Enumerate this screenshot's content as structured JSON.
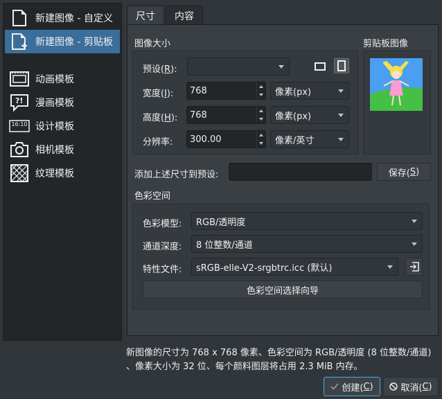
{
  "sidebar": {
    "items": [
      {
        "label": "新建图像 - 自定义",
        "icon": "new-document-icon"
      },
      {
        "label": "新建图像 - 剪贴板",
        "icon": "clipboard-document-icon"
      },
      {
        "label": "动画模板",
        "icon": "animation-template-icon"
      },
      {
        "label": "漫画模板",
        "icon": "comic-template-icon"
      },
      {
        "label": "设计模板",
        "icon": "design-template-icon"
      },
      {
        "label": "相机模板",
        "icon": "camera-template-icon"
      },
      {
        "label": "纹理模板",
        "icon": "texture-template-icon"
      }
    ],
    "design_icon_text": "16:10"
  },
  "tabs": [
    {
      "label": "尺寸"
    },
    {
      "label": "内容"
    }
  ],
  "size": {
    "group_title": "图像大小",
    "preset_label": "预设(",
    "preset_key": "R",
    "preset_suffix": "):",
    "preset_value": "",
    "width_label": "宽度(",
    "width_key": "I",
    "width_suffix": "):",
    "width_value": "768",
    "width_unit": "像素(px)",
    "height_label": "高度(",
    "height_key": "H",
    "height_suffix": "):",
    "height_value": "768",
    "height_unit": "像素(px)",
    "resolution_label": "分辨率:",
    "resolution_value": "300.00",
    "resolution_unit": "像素/英寸"
  },
  "clipboard": {
    "title": "剪贴板图像"
  },
  "save_preset": {
    "label": "添加上述尺寸到预设:",
    "value": "",
    "button_prefix": "保存(",
    "button_key": "S",
    "button_suffix": ")"
  },
  "color": {
    "group_title": "色彩空间",
    "model_label": "色彩模型:",
    "model_value": "RGB/透明度",
    "depth_label": "通道深度:",
    "depth_value": "8 位整数/通道",
    "profile_label": "特性文件:",
    "profile_value": "sRGB-elle-V2-srgbtrc.icc (默认)",
    "wizard_button": "色彩空间选择向导"
  },
  "footer": {
    "summary": "新图像的尺寸为 768 x 768 像素、色彩空间为 RGB/透明度 (8 位整数/通道) 、像素大小为 32 位、每个颜料图层将占用 2.3 MiB 内存。",
    "create_prefix": "创建(",
    "create_key": "C",
    "create_suffix": ")",
    "cancel_prefix": "取消(",
    "cancel_key": "C",
    "cancel_suffix": ")"
  },
  "colors": {
    "accent": "#3b6e9a",
    "focus": "#3daee9"
  }
}
